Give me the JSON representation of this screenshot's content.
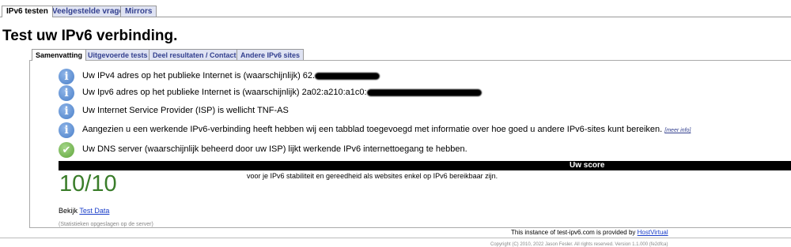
{
  "top_tabs": [
    "IPv6 testen",
    "Veelgestelde vragen",
    "Mirrors"
  ],
  "title": "Test uw IPv6 verbinding.",
  "sub_tabs": [
    "Samenvatting",
    "Uitgevoerde tests",
    "Deel resultaten / Contact",
    "Andere IPv6 sites"
  ],
  "results": [
    {
      "icon": "info-icon",
      "text": "Uw IPv4 adres op het publieke Internet is (waarschijnlijk) 62."
    },
    {
      "icon": "info-icon",
      "text": "Uw Ipv6 adres op het publieke Internet is (waarschijnlijk) 2a02:a210:a1c0:"
    },
    {
      "icon": "info-icon",
      "text": "Uw Internet Service Provider (ISP) is wellicht TNF-AS"
    },
    {
      "icon": "info-icon",
      "text": "Aangezien u een werkende IPv6-verbinding heeft hebben wij een tabblad toegevoegd met informatie over hoe goed u andere IPv6-sites kunt bereiken.",
      "link": "[meer info]"
    },
    {
      "icon": "check-icon",
      "text": "Uw DNS server (waarschijnlijk beheerd door uw ISP) lijkt werkende IPv6 internettoegang te hebben."
    }
  ],
  "score": {
    "header": "Uw score",
    "value": "10/10",
    "description": "voor je IPv6 stabiliteit en gereedheid als websites enkel op IPv6 bereikbaar zijn."
  },
  "bekijk": {
    "label": "Bekijk",
    "link": "Test Data"
  },
  "stats_note": "(Statistieken opgeslagen op de server)",
  "footer": {
    "instance_text": "This instance of test-ipv6.com is provided by",
    "provider": "HostVirtual",
    "copyright": "Copyright (C) 2010, 2022 Jason Fesler. All rights reserved. Version 1.1.000 (fe2dfca)"
  },
  "colors": {
    "score_green": "#3a7d2a",
    "tab_bg": "#dfe3f3",
    "link": "#1a3ec9"
  }
}
